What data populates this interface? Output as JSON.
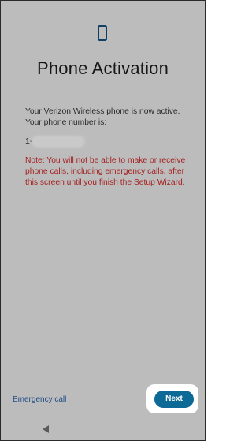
{
  "header": {
    "icon": "phone-icon",
    "title": "Phone Activation"
  },
  "main": {
    "intro_text": "Your Verizon Wireless phone is now active. Your phone number is:",
    "phone_number_prefix": "1-",
    "warning_text": "Note: You will not be able to make or receive phone calls, including emergency calls, after this screen until you finish the Setup Wizard."
  },
  "footer": {
    "emergency_call_label": "Emergency call",
    "next_label": "Next"
  },
  "nav": {
    "back_icon": "back-triangle-icon"
  },
  "colors": {
    "background": "#bcbcbc",
    "accent": "#0d6a96",
    "warning": "#a52020",
    "link": "#1f4b86"
  }
}
